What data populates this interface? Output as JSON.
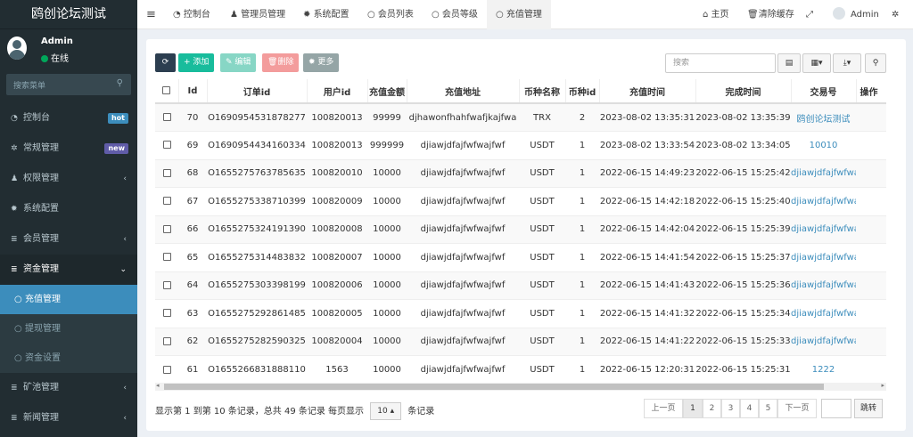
{
  "app_title": "鸥创论坛测试",
  "user": {
    "name": "Admin",
    "status": "在线"
  },
  "sidebar": {
    "search_placeholder": "搜索菜单",
    "items": [
      {
        "label": "控制台",
        "icon": "dashboard-icon",
        "badge": "hot",
        "badge_color": "#3c8dbc"
      },
      {
        "label": "常规管理",
        "icon": "cogs-icon",
        "badge": "new",
        "badge_color": "#605ca8"
      },
      {
        "label": "权限管理",
        "icon": "group-icon",
        "chevron": "‹"
      },
      {
        "label": "系统配置",
        "icon": "cog-icon"
      },
      {
        "label": "会员管理",
        "icon": "list-icon",
        "chevron": "‹"
      },
      {
        "label": "资金管理",
        "icon": "list-icon",
        "chevron": "⌄"
      }
    ],
    "sub_items": [
      {
        "label": "充值管理",
        "icon": "circle-icon"
      },
      {
        "label": "提现管理",
        "icon": "circle-icon"
      },
      {
        "label": "资金设置",
        "icon": "circle-icon"
      }
    ],
    "bottom_items": [
      {
        "label": "矿池管理",
        "icon": "list-icon",
        "chevron": "‹"
      },
      {
        "label": "新闻管理",
        "icon": "list-icon",
        "chevron": "‹"
      }
    ]
  },
  "topnav": {
    "menu_icon": "≡",
    "tabs": [
      {
        "label": "控制台",
        "icon": "dashboard-icon"
      },
      {
        "label": "管理员管理",
        "icon": "user-icon"
      },
      {
        "label": "系统配置",
        "icon": "cog-icon"
      },
      {
        "label": "会员列表",
        "icon": "circle-icon"
      },
      {
        "label": "会员等级",
        "icon": "circle-icon"
      },
      {
        "label": "充值管理",
        "icon": "circle-icon"
      }
    ],
    "right": [
      {
        "label": "主页",
        "icon": "home-icon"
      },
      {
        "label": "清除缓存",
        "icon": "trash-icon"
      },
      {
        "label": "",
        "icon": "fullscreen-icon"
      },
      {
        "label": "Admin",
        "icon": "avatar"
      },
      {
        "label": "",
        "icon": "cogs-icon"
      }
    ]
  },
  "toolbar": {
    "refresh": "",
    "add": "添加",
    "edit": "编辑",
    "delete": "删除",
    "more": "更多",
    "search_placeholder": "搜索",
    "colors": {
      "refresh": "#2c3e50",
      "add": "#18bc9c",
      "edit": "#87d6c5",
      "delete": "#f39c9c",
      "more": "#95a5a6"
    }
  },
  "table": {
    "columns": [
      "",
      "Id",
      "订单id",
      "用户id",
      "充值金额",
      "充值地址",
      "币种名称",
      "币种id",
      "充值时间",
      "完成时间",
      "交易号",
      "操作"
    ],
    "rows": [
      [
        "70",
        "O1690954531878277",
        "100820013",
        "99999",
        "djhawonfhahfwafjkajfwa",
        "TRX",
        "2",
        "2023-08-02 13:35:31",
        "2023-08-02 13:35:39",
        "鸥创论坛测试",
        ""
      ],
      [
        "69",
        "O1690954434160334",
        "100820013",
        "999999",
        "djiawjdfajfwfwajfwf",
        "USDT",
        "1",
        "2023-08-02 13:33:54",
        "2023-08-02 13:34:05",
        "10010",
        ""
      ],
      [
        "68",
        "O1655275763785635",
        "100820010",
        "10000",
        "djiawjdfajfwfwajfwf",
        "USDT",
        "1",
        "2022-06-15 14:49:23",
        "2022-06-15 15:25:42",
        "djiawjdfajfwfwajfwf",
        ""
      ],
      [
        "67",
        "O1655275338710399",
        "100820009",
        "10000",
        "djiawjdfajfwfwajfwf",
        "USDT",
        "1",
        "2022-06-15 14:42:18",
        "2022-06-15 15:25:40",
        "djiawjdfajfwfwajfwf",
        ""
      ],
      [
        "66",
        "O1655275324191390",
        "100820008",
        "10000",
        "djiawjdfajfwfwajfwf",
        "USDT",
        "1",
        "2022-06-15 14:42:04",
        "2022-06-15 15:25:39",
        "djiawjdfajfwfwajfwf",
        ""
      ],
      [
        "65",
        "O1655275314483832",
        "100820007",
        "10000",
        "djiawjdfajfwfwajfwf",
        "USDT",
        "1",
        "2022-06-15 14:41:54",
        "2022-06-15 15:25:37",
        "djiawjdfajfwfwajfwf",
        ""
      ],
      [
        "64",
        "O1655275303398199",
        "100820006",
        "10000",
        "djiawjdfajfwfwajfwf",
        "USDT",
        "1",
        "2022-06-15 14:41:43",
        "2022-06-15 15:25:36",
        "djiawjdfajfwfwajfwf",
        ""
      ],
      [
        "63",
        "O1655275292861485",
        "100820005",
        "10000",
        "djiawjdfajfwfwajfwf",
        "USDT",
        "1",
        "2022-06-15 14:41:32",
        "2022-06-15 15:25:34",
        "djiawjdfajfwfwajfwf",
        ""
      ],
      [
        "62",
        "O1655275282590325",
        "100820004",
        "10000",
        "djiawjdfajfwfwajfwf",
        "USDT",
        "1",
        "2022-06-15 14:41:22",
        "2022-06-15 15:25:33",
        "djiawjdfajfwfwajfwf",
        ""
      ],
      [
        "61",
        "O1655266831888110",
        "1563",
        "10000",
        "djiawjdfajfwfwajfwf",
        "USDT",
        "1",
        "2022-06-15 12:20:31",
        "2022-06-15 15:25:31",
        "1222",
        ""
      ]
    ]
  },
  "pagination": {
    "info_prefix": "显示第 1 到第 10 条记录，总共 49 条记录 每页显示",
    "page_size": "10",
    "info_suffix": "条记录",
    "prev": "上一页",
    "pages": [
      "1",
      "2",
      "3",
      "4",
      "5"
    ],
    "next": "下一页",
    "jump": "跳转"
  }
}
